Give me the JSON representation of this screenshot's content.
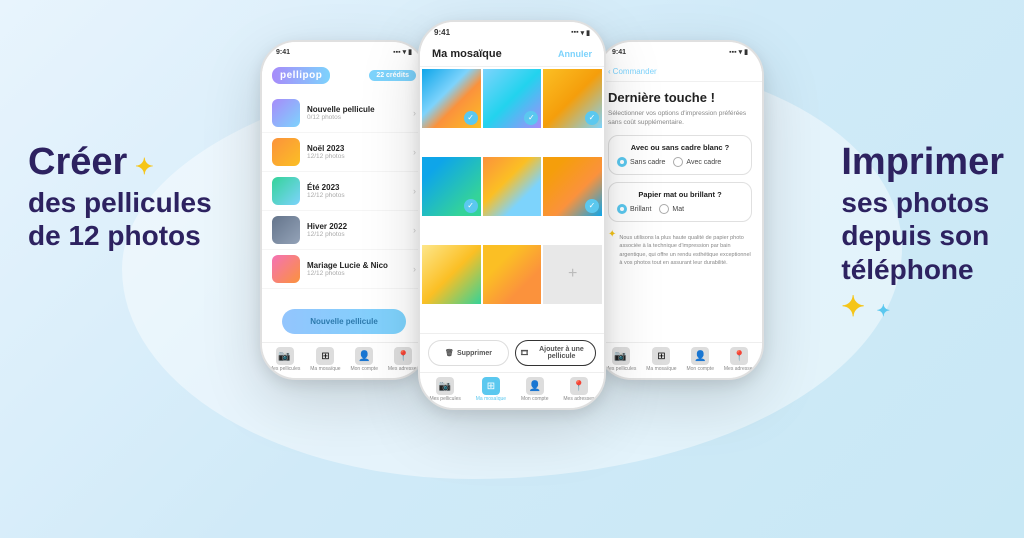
{
  "background": {
    "color": "#d0eaf8"
  },
  "left_text": {
    "creer": "Créer",
    "line1": "des pellicules",
    "line2": "de 12 photos"
  },
  "right_text": {
    "imprimer": "Imprimer",
    "line1": "ses photos",
    "line2": "depuis son",
    "line3": "téléphone"
  },
  "phone_left": {
    "time": "9:41",
    "logo": "pellipop",
    "credits": "22 crédits",
    "pellicules": [
      {
        "name": "Nouvelle pellicule",
        "count": "0/12 photos",
        "color": "gradient-1"
      },
      {
        "name": "Noël 2023",
        "count": "12/12 photos",
        "color": "gradient-2"
      },
      {
        "name": "Été 2023",
        "count": "12/12 photos",
        "color": "gradient-3"
      },
      {
        "name": "Hiver 2022",
        "count": "12/12 photos",
        "color": "gradient-4"
      },
      {
        "name": "Mariage Lucie & Nico",
        "count": "12/12 photos",
        "color": "gradient-5"
      }
    ],
    "new_button": "Nouvelle pellicule",
    "nav": [
      {
        "label": "Mes pellicules",
        "active": false
      },
      {
        "label": "Ma mosaïque",
        "active": false
      },
      {
        "label": "Mon compte",
        "active": false
      },
      {
        "label": "Mes adresses",
        "active": false
      }
    ]
  },
  "phone_center": {
    "time": "9:41",
    "title": "Ma mosaïque",
    "cancel": "Annuler",
    "delete_btn": "Supprimer",
    "add_btn": "Ajouter à une pellicule",
    "nav": [
      {
        "label": "Mes pellicules",
        "active": false
      },
      {
        "label": "Ma mosaïque",
        "active": true
      },
      {
        "label": "Mon compte",
        "active": false
      },
      {
        "label": "Mes adresses",
        "active": false
      }
    ]
  },
  "phone_right": {
    "time": "9:41",
    "back": "Commander",
    "heading": "Dernière touche !",
    "subtitle": "Sélectionner vos options d'impression préférées sans coût supplémentaire.",
    "option1": {
      "title": "Avec ou sans cadre blanc ?",
      "choices": [
        {
          "label": "Sans cadre",
          "selected": true
        },
        {
          "label": "Avec cadre",
          "selected": false
        }
      ]
    },
    "option2": {
      "title": "Papier mat ou brillant ?",
      "choices": [
        {
          "label": "Brillant",
          "selected": true
        },
        {
          "label": "Mat",
          "selected": false
        }
      ]
    },
    "info_text": "Nous utilisons la plus haute qualité de papier photo associée à la technique d'impression par bain argentique, qui offre un rendu esthétique exceptionnel à vos photos tout en assurant leur durabilité.",
    "nav": [
      {
        "label": "Mes pellicules",
        "active": false
      },
      {
        "label": "Ma mosaïque",
        "active": false
      },
      {
        "label": "Mon compte",
        "active": false
      },
      {
        "label": "Mes adresses",
        "active": false
      }
    ]
  }
}
